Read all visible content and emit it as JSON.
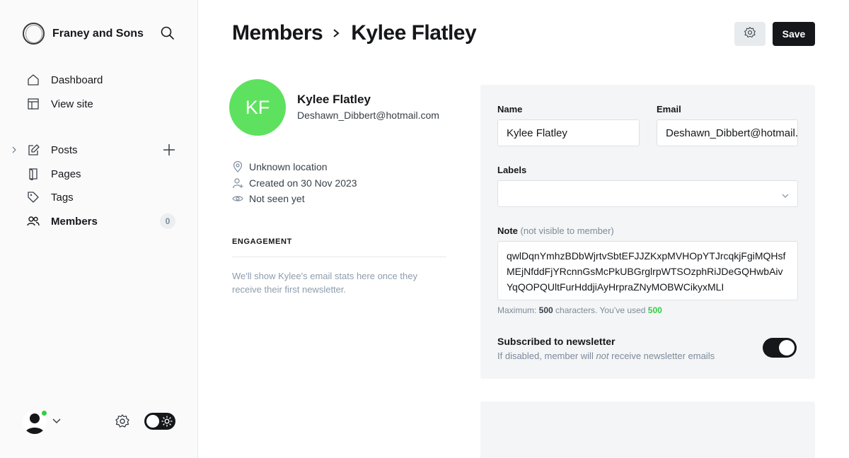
{
  "sidebar": {
    "brand": "Franey and Sons",
    "items": [
      {
        "label": "Dashboard",
        "icon": "home-icon"
      },
      {
        "label": "View site",
        "icon": "layout-icon"
      },
      {
        "label": "Posts",
        "icon": "pen-icon"
      },
      {
        "label": "Pages",
        "icon": "page-icon"
      },
      {
        "label": "Tags",
        "icon": "tag-icon"
      },
      {
        "label": "Members",
        "icon": "members-icon",
        "active": true,
        "count": "0"
      }
    ]
  },
  "header": {
    "breadcrumb_parent": "Members",
    "breadcrumb_current": "Kylee Flatley",
    "save_label": "Save"
  },
  "member": {
    "initials": "KF",
    "name": "Kylee Flatley",
    "email": "Deshawn_Dibbert@hotmail.com",
    "avatar_color": "#5fe160",
    "location": "Unknown location",
    "created": "Created on 30 Nov 2023",
    "last_seen": "Not seen yet"
  },
  "engagement": {
    "title": "ENGAGEMENT",
    "text": "We'll show Kylee's email stats here once they receive their first newsletter."
  },
  "form": {
    "name_label": "Name",
    "name_value": "Kylee Flatley",
    "email_label": "Email",
    "email_value": "Deshawn_Dibbert@hotmail.com",
    "labels_label": "Labels",
    "labels_value": "",
    "note_label": "Note",
    "note_hint": "(not visible to member)",
    "note_value": "qwlDqnYmhzBDbWjrtvSbtEFJJZKxpMVHOpYTJrcqkjFgiMQHsfMEjNfddFjYRcnnGsMcPkUBGrglrpWTSOzphRiJDeGQHwbAivYqQOPQUltFurHddjiAyHrpraZNyMOBWCikyxMLI",
    "note_count_prefix": "Maximum: ",
    "note_max": "500",
    "note_count_mid": " characters. You’ve used ",
    "note_used": "500",
    "subscribed_label": "Subscribed to newsletter",
    "subscribed_desc_a": "If disabled, member will ",
    "subscribed_desc_em": "not",
    "subscribed_desc_b": " receive newsletter emails",
    "subscribed": true
  },
  "colors": {
    "accent": "#30cf43",
    "dark": "#15171a"
  }
}
